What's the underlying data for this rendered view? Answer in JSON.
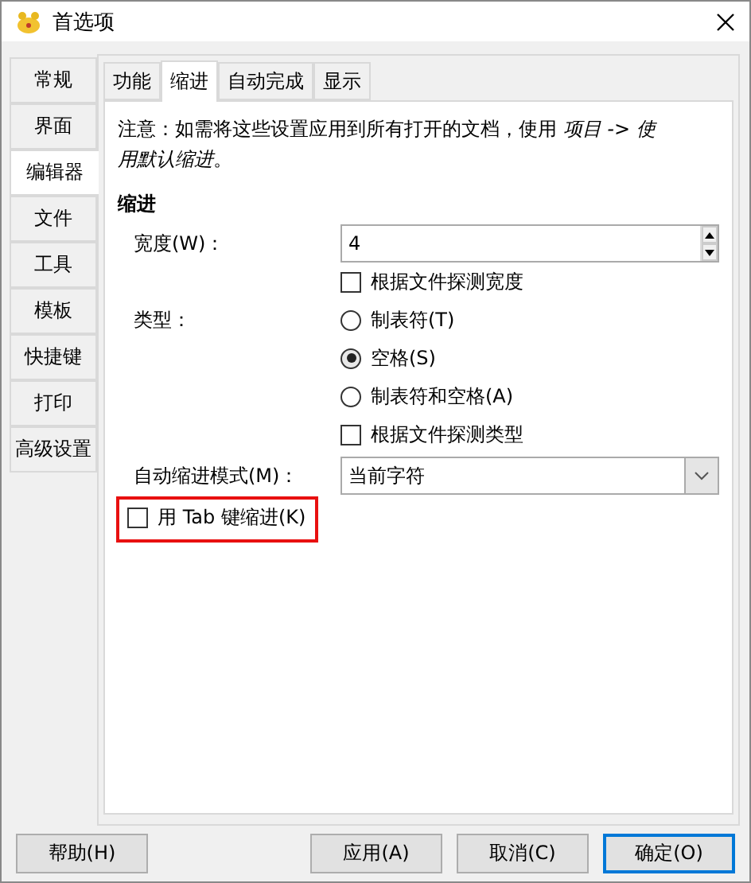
{
  "window": {
    "title": "首选项"
  },
  "sidebar": {
    "items": [
      {
        "label": "常规",
        "selected": false
      },
      {
        "label": "界面",
        "selected": false
      },
      {
        "label": "编辑器",
        "selected": true
      },
      {
        "label": "文件",
        "selected": false
      },
      {
        "label": "工具",
        "selected": false
      },
      {
        "label": "模板",
        "selected": false
      },
      {
        "label": "快捷键",
        "selected": false
      },
      {
        "label": "打印",
        "selected": false
      },
      {
        "label": "高级设置",
        "selected": false
      }
    ]
  },
  "tabs": [
    {
      "label": "功能",
      "selected": false
    },
    {
      "label": "缩进",
      "selected": true
    },
    {
      "label": "自动完成",
      "selected": false
    },
    {
      "label": "显示",
      "selected": false
    }
  ],
  "note": "注意：如需将这些设置应用到所有打开的文档，使用 *项目 -> 使用默认缩进*。",
  "section": "缩进",
  "width": {
    "label": "宽度(W)：",
    "value": "4"
  },
  "detect_width": {
    "label": "根据文件探测宽度",
    "checked": false
  },
  "type": {
    "label": "类型：",
    "options": [
      {
        "label": "制表符(T)",
        "selected": false
      },
      {
        "label": "空格(S)",
        "selected": true
      },
      {
        "label": "制表符和空格(A)",
        "selected": false
      }
    ]
  },
  "detect_type": {
    "label": "根据文件探测类型",
    "checked": false
  },
  "auto_indent": {
    "label": "自动缩进模式(M)：",
    "value": "当前字符"
  },
  "tab_indent": {
    "label": "用 Tab 键缩进(K)",
    "checked": false,
    "highlighted": true
  },
  "buttons": [
    {
      "label": "帮助(H)",
      "default": false
    },
    {
      "label": "应用(A)",
      "default": false
    },
    {
      "label": "取消(C)",
      "default": false
    },
    {
      "label": "确定(O)",
      "default": true
    }
  ]
}
